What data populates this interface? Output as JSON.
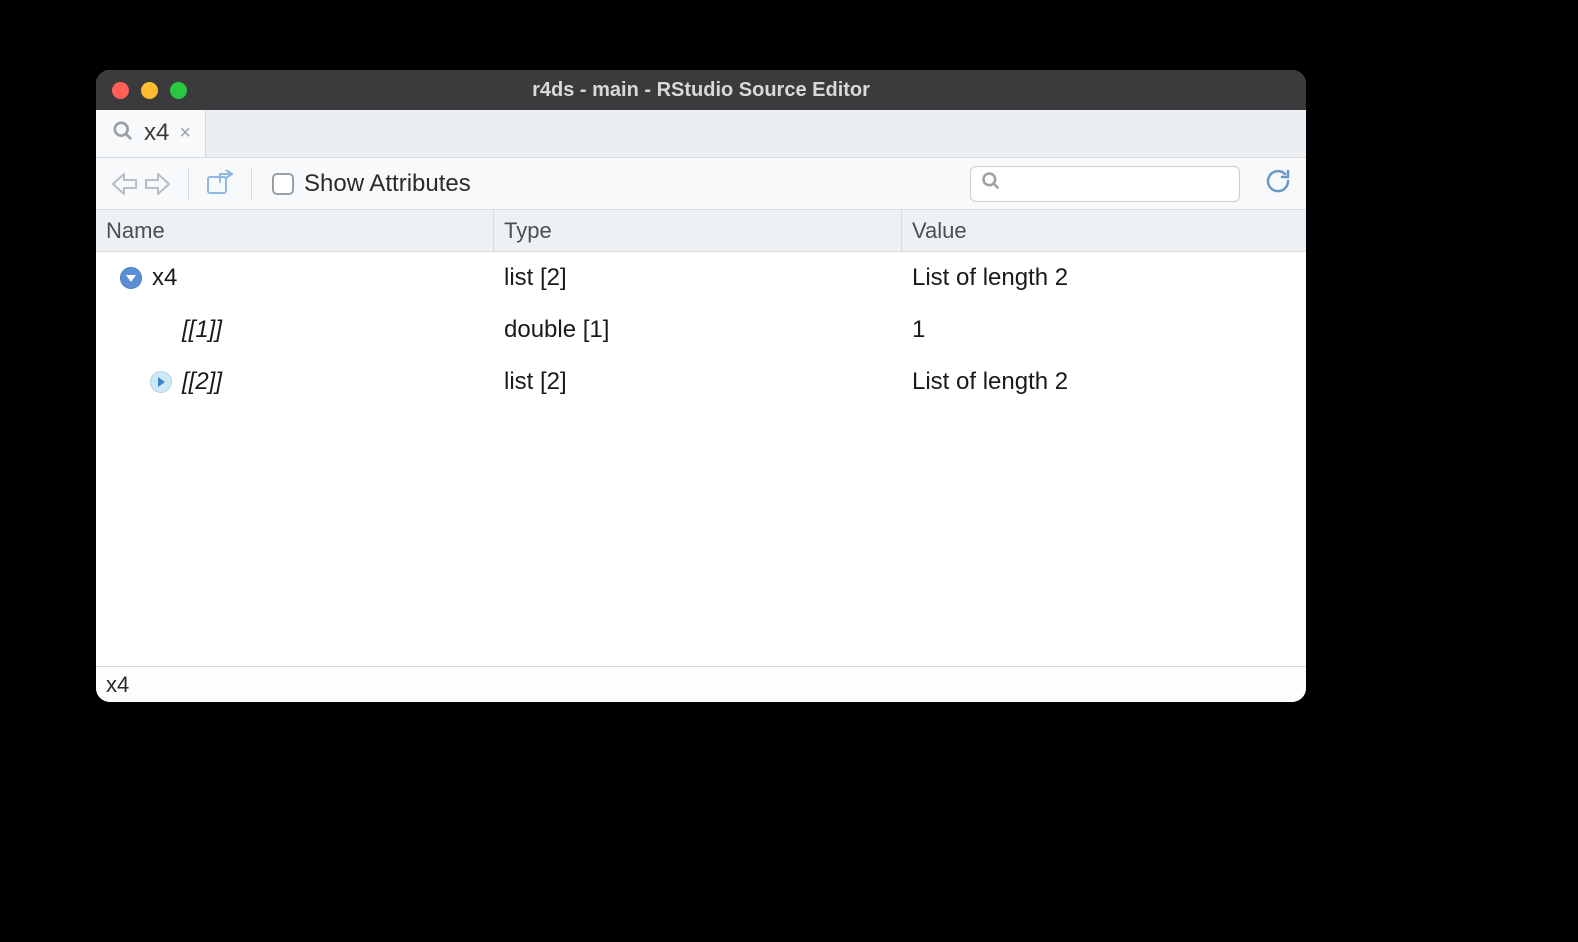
{
  "window": {
    "title": "r4ds - main - RStudio Source Editor"
  },
  "tab": {
    "label": "x4"
  },
  "toolbar": {
    "show_attributes_label": "Show Attributes",
    "search_placeholder": ""
  },
  "columns": {
    "name": "Name",
    "type": "Type",
    "value": "Value"
  },
  "rows": [
    {
      "indent": 24,
      "exp": "down",
      "italic": false,
      "name": "x4",
      "type": "list [2]",
      "value": "List of length 2"
    },
    {
      "indent": 86,
      "exp": "none",
      "italic": true,
      "name": "[[1]]",
      "type": "double [1]",
      "value": "1"
    },
    {
      "indent": 54,
      "exp": "right",
      "italic": true,
      "name": "[[2]]",
      "type": "list [2]",
      "value": "List of length 2"
    }
  ],
  "status": {
    "path": "x4"
  }
}
